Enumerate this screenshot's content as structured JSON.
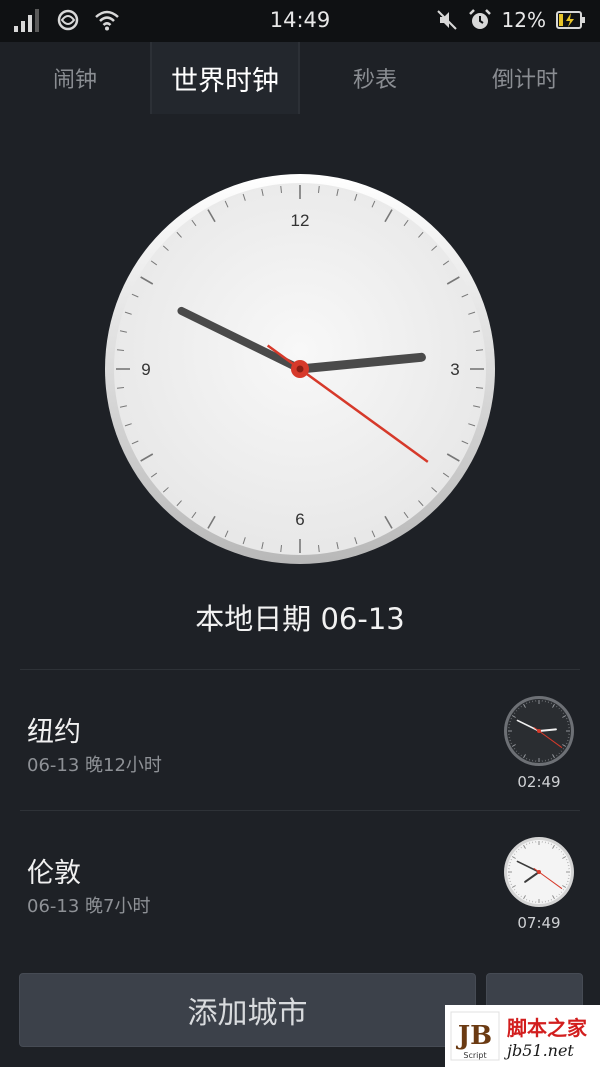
{
  "status_bar": {
    "time": "14:49",
    "battery_percent": "12%",
    "icons": [
      "signal-icon",
      "mobile-network-icon",
      "wifi-icon",
      "mute-icon",
      "alarm-icon",
      "battery-charging-icon"
    ]
  },
  "tabs": [
    {
      "label": "闹钟",
      "active": false
    },
    {
      "label": "世界时钟",
      "active": true
    },
    {
      "label": "秒表",
      "active": false
    },
    {
      "label": "倒计时",
      "active": false
    }
  ],
  "main_clock": {
    "hour_labels": {
      "twelve": "12",
      "three": "3",
      "six": "6",
      "nine": "9"
    },
    "time": {
      "hour": 14,
      "minute": 49,
      "second": 21
    }
  },
  "local_date_text": "本地日期 06-13",
  "cities": [
    {
      "name": "纽约",
      "info": "06-13  晚12小时",
      "time": "02:49",
      "clock_style": "dark",
      "hour": 2,
      "minute": 49,
      "second": 21
    },
    {
      "name": "伦敦",
      "info": "06-13  晚7小时",
      "time": "07:49",
      "clock_style": "light",
      "hour": 7,
      "minute": 49,
      "second": 21
    }
  ],
  "add_city_label": "添加城市",
  "watermark": {
    "cn": "脚本之家",
    "en": "jb51.net",
    "logo_letters": "JB",
    "logo_sub": "Script"
  },
  "colors": {
    "background": "#1e2126",
    "second_hand": "#d6392a",
    "hand": "#4a4a4a"
  }
}
